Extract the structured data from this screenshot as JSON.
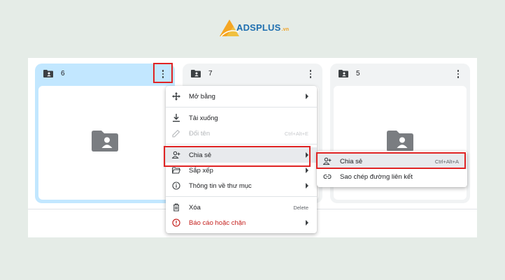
{
  "brand": {
    "name": "ADSPLUS",
    "tld": ".vn"
  },
  "cards": [
    {
      "title": "6",
      "selected": true
    },
    {
      "title": "7",
      "selected": false
    },
    {
      "title": "5",
      "selected": false
    }
  ],
  "context_menu": {
    "items": [
      {
        "label": "Mở bằng",
        "icon": "move-arrows-icon",
        "submenu": true
      },
      {
        "label": "Tải xuống",
        "icon": "download-icon"
      },
      {
        "label": "Đổi tên",
        "icon": "rename-pencil-icon",
        "shortcut": "Ctrl+Alt+E",
        "disabled": true
      },
      {
        "label": "Chia sẻ",
        "icon": "share-person-add-icon",
        "submenu": true,
        "active": true
      },
      {
        "label": "Sắp xếp",
        "icon": "folder-open-icon",
        "submenu": true
      },
      {
        "label": "Thông tin về thư mục",
        "icon": "info-icon",
        "submenu": true
      },
      {
        "label": "Xóa",
        "icon": "trash-icon",
        "shortcut": "Delete"
      },
      {
        "label": "Báo cáo hoặc chặn",
        "icon": "report-icon",
        "submenu": true,
        "danger": true
      }
    ]
  },
  "share_submenu": {
    "items": [
      {
        "label": "Chia sẻ",
        "icon": "share-person-add-icon",
        "shortcut": "Ctrl+Alt+A",
        "active": true
      },
      {
        "label": "Sao chép đường liên kết",
        "icon": "link-icon"
      }
    ]
  },
  "colors": {
    "page_bg": "#e5ece7",
    "selected_card": "#c2e7ff",
    "card_bg": "#f1f3f4",
    "highlight_red": "#e02424",
    "danger_text": "#c5221f",
    "brand_blue": "#1f6fb0",
    "brand_orange": "#f0a020"
  }
}
